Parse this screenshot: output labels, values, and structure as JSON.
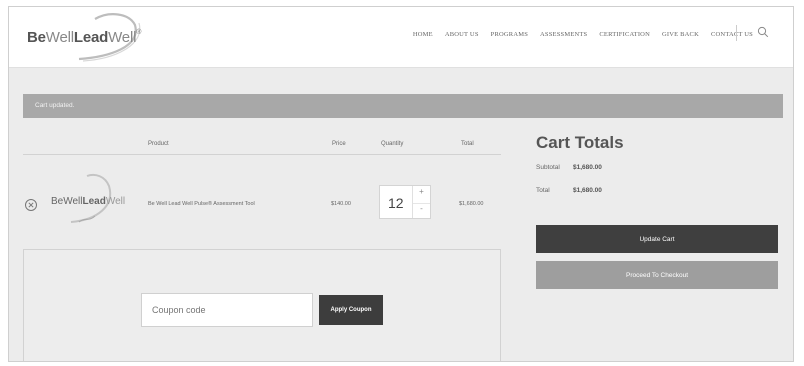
{
  "header": {
    "logo": {
      "be": "Be",
      "well": "Well",
      "lead": "Lead",
      "well2": "Well",
      "reg": "®"
    },
    "nav": [
      "HOME",
      "ABOUT US",
      "PROGRAMS",
      "ASSESSMENTS",
      "CERTIFICATION",
      "GIVE BACK",
      "CONTACT US"
    ]
  },
  "notice": {
    "text": "Cart updated."
  },
  "table": {
    "headers": {
      "product": "Product",
      "price": "Price",
      "quantity": "Quantity",
      "total": "Total"
    },
    "row": {
      "logo_text_a": "BeWell",
      "logo_text_b": "Lead",
      "logo_text_c": "Well",
      "product_name": "Be Well Lead Well Pulse® Assessment Tool",
      "price": "$140.00",
      "quantity": "12",
      "total": "$1,680.00",
      "qty_up": "+",
      "qty_down": "-"
    }
  },
  "coupon": {
    "placeholder": "Coupon code",
    "apply_label": "Apply Coupon"
  },
  "totals": {
    "title": "Cart Totals",
    "subtotal_label": "Subtotal",
    "subtotal_value": "$1,680.00",
    "total_label": "Total",
    "total_value": "$1,680.00",
    "update_label": "Update Cart",
    "checkout_label": "Proceed To Checkout"
  }
}
